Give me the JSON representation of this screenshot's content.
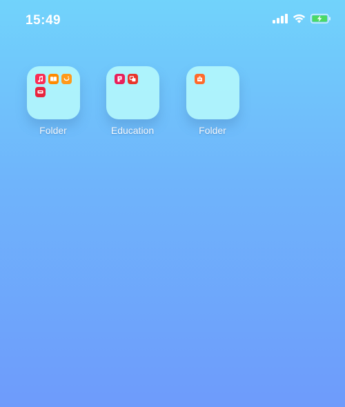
{
  "status_bar": {
    "time": "15:49",
    "icons": [
      "cellular-signal-icon",
      "wifi-icon",
      "battery-charging-icon"
    ],
    "battery_color": "#4cd964"
  },
  "folders": [
    {
      "label": "Folder",
      "apps": [
        {
          "icon": "music-app-icon",
          "color": "#fa2d55"
        },
        {
          "icon": "books-app-icon",
          "color": "#ff8a00"
        },
        {
          "icon": "smile-app-icon",
          "color": "#ff9a1a"
        },
        {
          "icon": "red-app-icon",
          "color": "#e8243e"
        }
      ]
    },
    {
      "label": "Education",
      "apps": [
        {
          "icon": "e-app-icon",
          "color": "#e8205a"
        },
        {
          "icon": "translate-app-icon",
          "color": "#e8352b"
        }
      ]
    },
    {
      "label": "Folder",
      "apps": [
        {
          "icon": "orange-app-icon",
          "color": "#ff6a2b"
        }
      ]
    }
  ]
}
